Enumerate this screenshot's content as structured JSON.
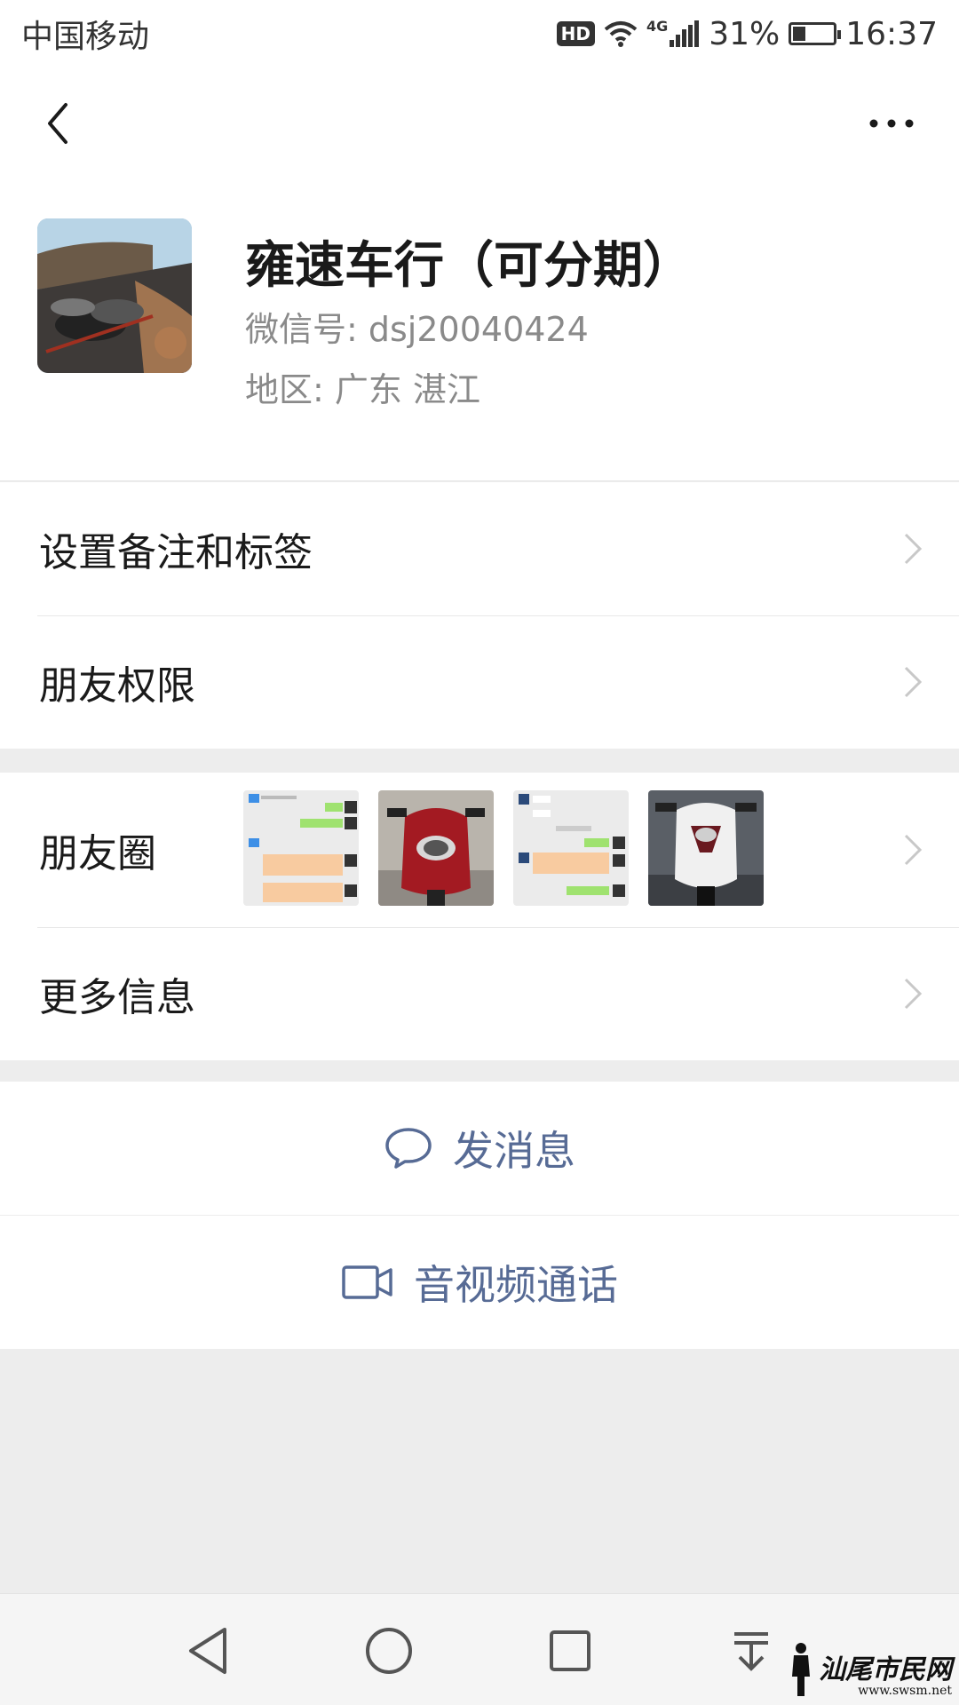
{
  "status_bar": {
    "carrier": "中国移动",
    "hd": "HD",
    "network": "4G",
    "battery": "31%",
    "time": "16:37"
  },
  "nav": {
    "back_icon": "chevron-left-icon",
    "more_icon": "ellipsis-icon"
  },
  "profile": {
    "name": "雍速车行（可分期）",
    "wechat_id": "微信号: dsj20040424",
    "region": "地区: 广东  湛江"
  },
  "menu": {
    "remark_tags": "设置备注和标签",
    "friend_permissions": "朋友权限",
    "moments": "朋友圈",
    "more_info": "更多信息"
  },
  "actions": {
    "send_message": "发消息",
    "video_call": "音视频通话"
  },
  "watermark": {
    "name": "汕尾市民网",
    "url": "www.swsm.net"
  },
  "colors": {
    "link_blue": "#576b95",
    "background": "#ededed"
  }
}
